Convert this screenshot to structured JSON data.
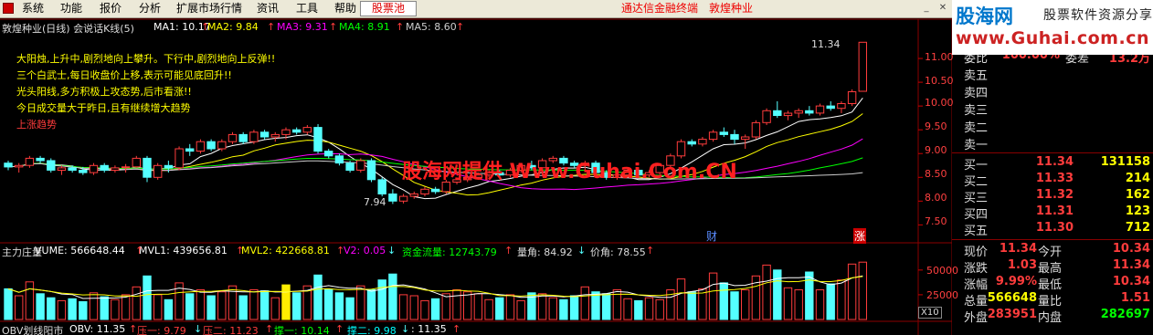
{
  "menu": {
    "items": [
      "系统",
      "功能",
      "报价",
      "分析",
      "扩展市场行情",
      "资讯",
      "工具",
      "帮助"
    ],
    "stock_pool": "股票池",
    "terminal_title": "通达信金融终端",
    "stock_name": "敦煌种业"
  },
  "watermark": {
    "line1": "股海网",
    "line1b": "股票软件资源分享",
    "line2": "www.Guhai.com.cn",
    "center": "股海网提供 Www.Guhai.Com.CN"
  },
  "kline_header": {
    "title": "敦煌种业(日线) 会说话K线(5)",
    "ma1": "MA1: 10.17",
    "ma2": "MA2: 9.84",
    "ma3": "MA3: 9.31",
    "ma4": "MA4: 8.91",
    "ma5": "MA5: 8.60"
  },
  "annotations": [
    "大阳烛,上升中,剧烈地向上攀升。下行中,剧烈地向上反弹!!",
    "三个白武士,每日收盘价上移,表示可能见底回升!!",
    "光头阳线,多方积极上攻态势,后市看涨!!",
    "今日成交量大于昨日,且有继续增大趋势",
    "上涨趋势"
  ],
  "price_axis": [
    "11.00",
    "10.50",
    "10.00",
    "9.50",
    "9.00",
    "8.50",
    "8.00",
    "7.50"
  ],
  "high_label": "11.34",
  "low_label": "7.94",
  "markers": {
    "cai": "财",
    "zhang": "涨"
  },
  "vol_header": {
    "title": "主力庄量",
    "vume": "VUME: 566648.44",
    "mvl1": "MVL1: 439656.81",
    "mvl2": "MVL2: 422668.81",
    "v2": "V2: 0.05",
    "capital": "资金流量: 12743.79",
    "vol_angle": "量角: 84.92",
    "price_angle": "价角: 78.55"
  },
  "vol_axis": [
    "50000",
    "25000"
  ],
  "vol_unit": "X10",
  "obv_header": {
    "title": "OBV划线阳市",
    "obv": "OBV: 11.35",
    "ya1": "压一: 9.79",
    "ya2": "压二: 11.23",
    "cheng1": "撑一: 10.14",
    "cheng2": "撑二: 9.98",
    "last": ": 11.35"
  },
  "quote": {
    "top_line": {
      "l1": "委比",
      "v1": "100.00%",
      "l2": "委差",
      "v2": "13.2万"
    },
    "sell": [
      {
        "label": "卖五",
        "price": "",
        "vol": ""
      },
      {
        "label": "卖四",
        "price": "",
        "vol": ""
      },
      {
        "label": "卖三",
        "price": "",
        "vol": ""
      },
      {
        "label": "卖二",
        "price": "",
        "vol": ""
      },
      {
        "label": "卖一",
        "price": "",
        "vol": ""
      }
    ],
    "buy": [
      {
        "label": "买一",
        "price": "11.34",
        "vol": "131158"
      },
      {
        "label": "买二",
        "price": "11.33",
        "vol": "214"
      },
      {
        "label": "买三",
        "price": "11.32",
        "vol": "162"
      },
      {
        "label": "买四",
        "price": "11.31",
        "vol": "123"
      },
      {
        "label": "买五",
        "price": "11.30",
        "vol": "712"
      }
    ],
    "stats": [
      {
        "l1": "现价",
        "v1": "11.34",
        "l2": "今开",
        "v2": "10.34"
      },
      {
        "l1": "涨跌",
        "v1": "1.03",
        "l2": "最高",
        "v2": "11.34"
      },
      {
        "l1": "涨幅",
        "v1": "9.99%",
        "l2": "最低",
        "v2": "10.34"
      },
      {
        "l1": "总量",
        "v1": "566648",
        "l2": "量比",
        "v2": "1.51"
      },
      {
        "l1": "外盘",
        "v1": "283951",
        "l2": "内盘",
        "v2": "282697"
      }
    ]
  },
  "chart_data": {
    "type": "candlestick",
    "price_range": [
      7.2,
      11.5
    ],
    "candles": [
      [
        8.8,
        8.85,
        8.65,
        8.72
      ],
      [
        8.72,
        8.8,
        8.6,
        8.75
      ],
      [
        8.75,
        8.95,
        8.7,
        8.9
      ],
      [
        8.9,
        8.95,
        8.8,
        8.85
      ],
      [
        8.85,
        8.9,
        8.6,
        8.65
      ],
      [
        8.65,
        8.75,
        8.55,
        8.7
      ],
      [
        8.7,
        8.75,
        8.6,
        8.65
      ],
      [
        8.65,
        8.72,
        8.55,
        8.6
      ],
      [
        8.6,
        8.8,
        8.55,
        8.75
      ],
      [
        8.75,
        8.8,
        8.6,
        8.65
      ],
      [
        8.65,
        8.75,
        8.6,
        8.7
      ],
      [
        8.7,
        8.78,
        8.6,
        8.72
      ],
      [
        8.72,
        8.95,
        8.7,
        8.9
      ],
      [
        8.9,
        8.95,
        8.4,
        8.5
      ],
      [
        8.5,
        8.8,
        8.45,
        8.75
      ],
      [
        8.75,
        8.85,
        8.6,
        8.7
      ],
      [
        8.7,
        9.15,
        8.65,
        9.1
      ],
      [
        9.1,
        9.2,
        8.95,
        9.05
      ],
      [
        9.05,
        9.3,
        9.0,
        9.25
      ],
      [
        9.25,
        9.3,
        9.05,
        9.1
      ],
      [
        9.1,
        9.3,
        9.05,
        9.25
      ],
      [
        9.25,
        9.45,
        9.2,
        9.4
      ],
      [
        9.4,
        9.45,
        9.2,
        9.25
      ],
      [
        9.25,
        9.5,
        9.2,
        9.45
      ],
      [
        9.45,
        9.5,
        9.3,
        9.35
      ],
      [
        9.35,
        9.45,
        9.25,
        9.4
      ],
      [
        9.4,
        9.55,
        9.3,
        9.5
      ],
      [
        9.5,
        9.55,
        9.4,
        9.45
      ],
      [
        9.45,
        9.6,
        9.4,
        9.55
      ],
      [
        9.55,
        9.62,
        9.0,
        9.05
      ],
      [
        9.05,
        9.1,
        8.9,
        8.95
      ],
      [
        8.95,
        9.0,
        8.75,
        8.8
      ],
      [
        8.8,
        8.85,
        8.6,
        8.65
      ],
      [
        8.65,
        8.9,
        8.6,
        8.85
      ],
      [
        8.85,
        8.9,
        8.4,
        8.45
      ],
      [
        8.45,
        8.5,
        8.1,
        8.15
      ],
      [
        8.15,
        8.25,
        7.94,
        8.0
      ],
      [
        8.0,
        8.15,
        7.95,
        8.1
      ],
      [
        8.1,
        8.2,
        8.05,
        8.15
      ],
      [
        8.15,
        8.3,
        8.1,
        8.25
      ],
      [
        8.25,
        8.3,
        8.15,
        8.2
      ],
      [
        8.2,
        8.45,
        8.15,
        8.4
      ],
      [
        8.4,
        8.5,
        8.35,
        8.45
      ],
      [
        8.45,
        8.55,
        8.4,
        8.5
      ],
      [
        8.5,
        8.6,
        8.45,
        8.55
      ],
      [
        8.55,
        8.65,
        8.5,
        8.6
      ],
      [
        8.6,
        8.65,
        8.5,
        8.55
      ],
      [
        8.55,
        8.7,
        8.5,
        8.65
      ],
      [
        8.65,
        8.8,
        8.6,
        8.75
      ],
      [
        8.75,
        8.85,
        8.65,
        8.7
      ],
      [
        8.7,
        8.9,
        8.65,
        8.85
      ],
      [
        8.85,
        8.95,
        8.8,
        8.9
      ],
      [
        8.9,
        8.95,
        8.75,
        8.8
      ],
      [
        8.8,
        8.85,
        8.7,
        8.75
      ],
      [
        8.75,
        8.85,
        8.65,
        8.8
      ],
      [
        8.8,
        8.85,
        8.55,
        8.6
      ],
      [
        8.6,
        8.65,
        8.45,
        8.5
      ],
      [
        8.5,
        8.6,
        8.45,
        8.55
      ],
      [
        8.55,
        8.7,
        8.5,
        8.65
      ],
      [
        8.65,
        8.7,
        8.5,
        8.55
      ],
      [
        8.55,
        8.65,
        8.5,
        8.6
      ],
      [
        8.6,
        8.8,
        8.55,
        8.75
      ],
      [
        8.75,
        9.0,
        8.7,
        8.95
      ],
      [
        8.95,
        9.3,
        8.9,
        9.25
      ],
      [
        9.25,
        9.3,
        9.15,
        9.2
      ],
      [
        9.2,
        9.35,
        9.15,
        9.3
      ],
      [
        9.3,
        9.5,
        9.25,
        9.45
      ],
      [
        9.45,
        9.55,
        9.35,
        9.4
      ],
      [
        9.4,
        9.5,
        9.2,
        9.3
      ],
      [
        9.3,
        9.4,
        9.1,
        9.35
      ],
      [
        9.35,
        9.7,
        9.3,
        9.65
      ],
      [
        9.65,
        9.95,
        9.6,
        9.9
      ],
      [
        9.9,
        10.1,
        9.75,
        9.8
      ],
      [
        9.8,
        9.9,
        9.7,
        9.85
      ],
      [
        9.85,
        9.95,
        9.75,
        9.9
      ],
      [
        9.9,
        10.0,
        9.8,
        9.85
      ],
      [
        9.85,
        10.05,
        9.8,
        10.0
      ],
      [
        10.0,
        10.1,
        9.9,
        9.95
      ],
      [
        9.95,
        10.1,
        9.85,
        10.05
      ],
      [
        10.05,
        10.35,
        10.0,
        10.3
      ],
      [
        10.31,
        11.34,
        10.34,
        11.34
      ]
    ],
    "moving_averages": [
      {
        "name": "MA1",
        "value": 10.17,
        "color": "#ffffff"
      },
      {
        "name": "MA2",
        "value": 9.84,
        "color": "#ffff00"
      },
      {
        "name": "MA3",
        "value": 9.31,
        "color": "#ff00ff"
      },
      {
        "name": "MA4",
        "value": 8.91,
        "color": "#00ff00"
      },
      {
        "name": "MA5",
        "value": 8.6,
        "color": "#cccccc"
      }
    ],
    "volume": [
      31000,
      24000,
      38000,
      26000,
      22000,
      19000,
      21000,
      18000,
      27000,
      23000,
      20000,
      25000,
      33000,
      44000,
      25000,
      20000,
      37000,
      26000,
      30000,
      24000,
      28000,
      34000,
      24000,
      30000,
      29000,
      22000,
      35000,
      27000,
      34000,
      45000,
      30000,
      27000,
      22000,
      34000,
      30000,
      40000,
      46000,
      25000,
      24000,
      19000,
      21000,
      26000,
      30000,
      28000,
      26000,
      20000,
      22000,
      25000,
      19000,
      27000,
      26000,
      22000,
      20000,
      24000,
      33000,
      28000,
      26000,
      30000,
      21000,
      19000,
      22000,
      20000,
      30000,
      41000,
      28000,
      31000,
      47000,
      37000,
      28000,
      30000,
      44000,
      55000,
      50000,
      32000,
      30000,
      48000,
      30000,
      36000,
      40000,
      56000,
      58000
    ],
    "vol_range": [
      0,
      60000
    ],
    "colors": {
      "up": "#ff3c3c",
      "down": "#54ffff",
      "highlight": "#ffee00"
    }
  }
}
